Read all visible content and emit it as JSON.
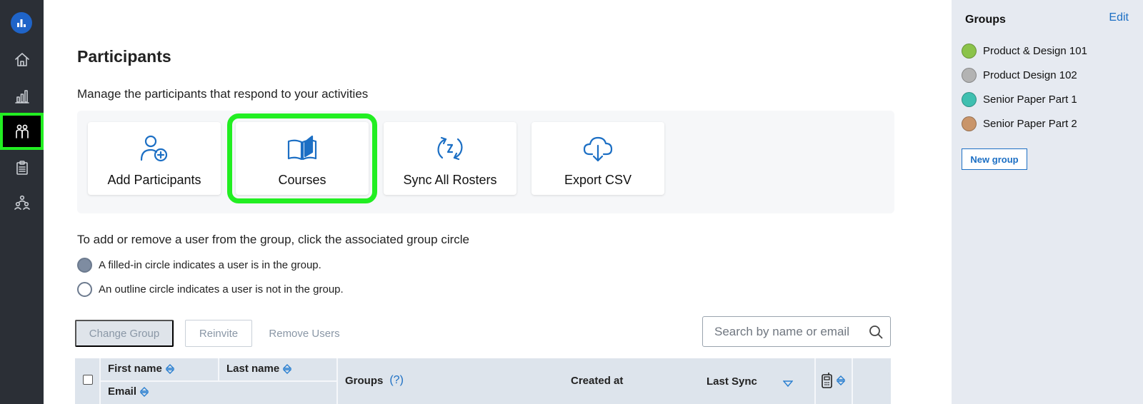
{
  "nav": {
    "items": [
      {
        "name": "home-icon"
      },
      {
        "name": "analytics-icon"
      },
      {
        "name": "participants-icon",
        "active": true
      },
      {
        "name": "clipboard-icon"
      },
      {
        "name": "team-icon"
      }
    ]
  },
  "main": {
    "title": "Participants",
    "subtitle": "Manage the participants that respond to your activities",
    "tiles": [
      {
        "label": "Add Participants",
        "icon": "add-user-icon"
      },
      {
        "label": "Courses",
        "icon": "book-icon",
        "highlighted": true
      },
      {
        "label": "Sync All Rosters",
        "icon": "sync-icon"
      },
      {
        "label": "Export CSV",
        "icon": "cloud-download-icon"
      }
    ],
    "instructions": {
      "title": "To  add or remove a user from the group, click the associated group circle",
      "filled": "A filled-in circle indicates a user is in the group.",
      "outline": "An outline circle indicates a user is not in the group."
    },
    "actions": {
      "change_group": "Change Group",
      "reinvite": "Reinvite",
      "remove_users": "Remove Users"
    },
    "search": {
      "placeholder": "Search by name or email",
      "value": ""
    },
    "table": {
      "first_name": "First name",
      "last_name": "Last name",
      "email": "Email",
      "groups": "Groups",
      "groups_help": "(?)",
      "created_at": "Created at",
      "last_sync": "Last Sync"
    }
  },
  "groups_panel": {
    "title": "Groups",
    "edit": "Edit",
    "groups": [
      {
        "name": "Product & Design 101",
        "color": "#8bc34a"
      },
      {
        "name": "Product Design 102",
        "color": "#b3b3b3"
      },
      {
        "name": "Senior Paper Part 1",
        "color": "#3fbfb0"
      },
      {
        "name": "Senior Paper Part 2",
        "color": "#c9956a"
      }
    ],
    "new_group": "New group"
  },
  "colors": {
    "accent": "#1c6fc4",
    "rail": "#2b2f36",
    "highlight": "#22ee22"
  }
}
